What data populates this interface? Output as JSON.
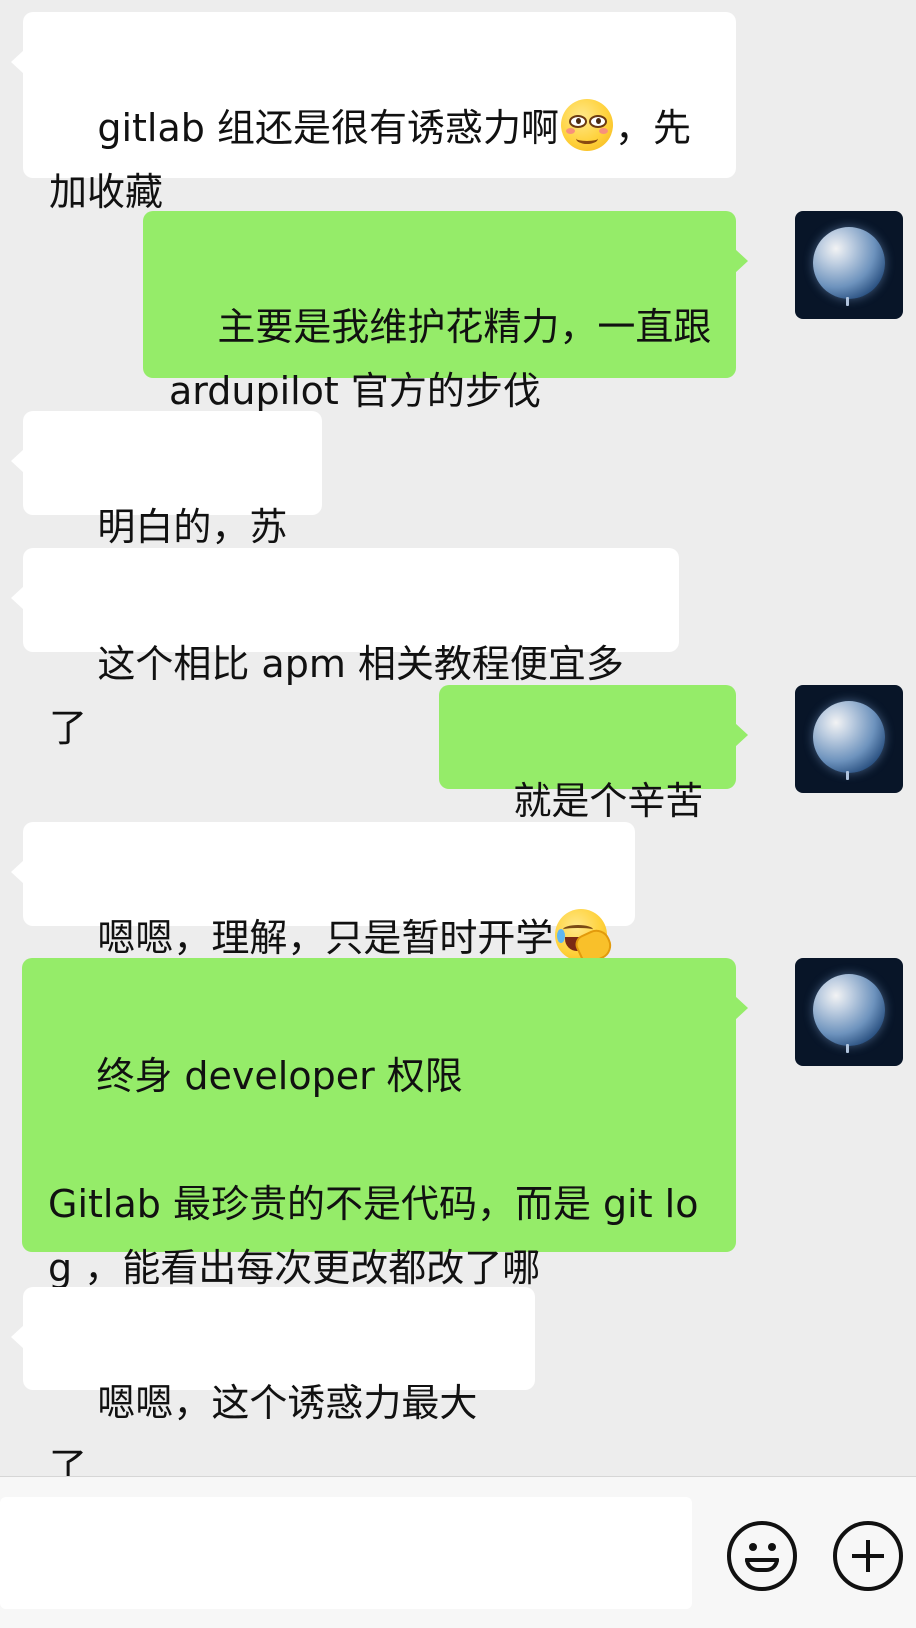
{
  "messages": [
    {
      "direction": "incoming",
      "text_before_emoji": "gitlab 组还是很有诱惑力啊",
      "emoji": "smiling-face-emoji",
      "text_after_emoji": "，先加收藏"
    },
    {
      "direction": "outgoing",
      "text": "主要是我维护花精力，一直跟 ardupilot 官方的步伐"
    },
    {
      "direction": "incoming",
      "text": "明白的，苏哥"
    },
    {
      "direction": "incoming",
      "text": "这个相比 apm 相关教程便宜多了"
    },
    {
      "direction": "outgoing",
      "text": "就是个辛苦费"
    },
    {
      "direction": "incoming",
      "text_before_emoji": "嗯嗯，理解，只是暂时开学",
      "emoji": "facepalm-emoji"
    },
    {
      "direction": "outgoing",
      "text": "终身 developer 权限\n\nGitlab 最珍贵的不是代码，而是 git log ，能看出每次更改都改了哪"
    },
    {
      "direction": "incoming",
      "text": "嗯嗯，这个诱惑力最大了"
    }
  ],
  "avatar": {
    "icon": "earth-avatar-icon"
  },
  "input_bar": {
    "value": "",
    "emoji_button_icon": "smiley-icon",
    "more_button_icon": "plus-circle-icon"
  },
  "colors": {
    "background": "#ededed",
    "incoming_bubble": "#ffffff",
    "outgoing_bubble": "#95ec69",
    "text": "#111111"
  }
}
